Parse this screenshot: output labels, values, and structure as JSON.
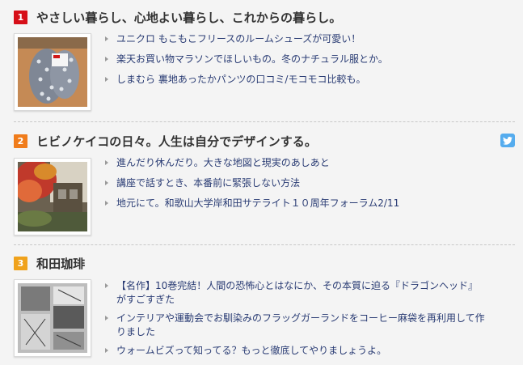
{
  "entries": [
    {
      "rank": "1",
      "badge_color": "#d60e18",
      "title": "やさしい暮らし、心地よい暮らし、これからの暮らし。",
      "has_twitter": false,
      "thumb_icon": "slippers-photo",
      "links": [
        "ユニクロ もこもこフリースのルームシューズが可愛い！",
        "楽天お買い物マラソンでほしいもの。冬のナチュラル服とか。",
        "しまむら 裏地あったかパンツの口コミ/モコモコ比較も。"
      ]
    },
    {
      "rank": "2",
      "badge_color": "#f07c1b",
      "title": "ヒビノケイコの日々。人生は自分でデザインする。",
      "has_twitter": true,
      "thumb_icon": "autumn-house-photo",
      "links": [
        "進んだり休んだり。大きな地図と現実のあしあと",
        "講座で話すとき、本番前に緊張しない方法",
        "地元にて。和歌山大学岸和田サテライト１０周年フォーラム2/11"
      ]
    },
    {
      "rank": "3",
      "badge_color": "#f0a21b",
      "title": "和田珈琲",
      "has_twitter": false,
      "thumb_icon": "manga-page-photo",
      "links": [
        "【名作】10巻完結！人間の恐怖心とはなにか、その本質に迫る『ドラゴンヘッド』\nがすごすぎた",
        "インテリアや運動会でお馴染みのフラッグガーランドをコーヒー麻袋を再利用して作\nりました",
        "ウォームビズって知ってる？もっと徹底してやりましょうよ。"
      ]
    }
  ],
  "twitter_icon": "twitter-bird-icon"
}
